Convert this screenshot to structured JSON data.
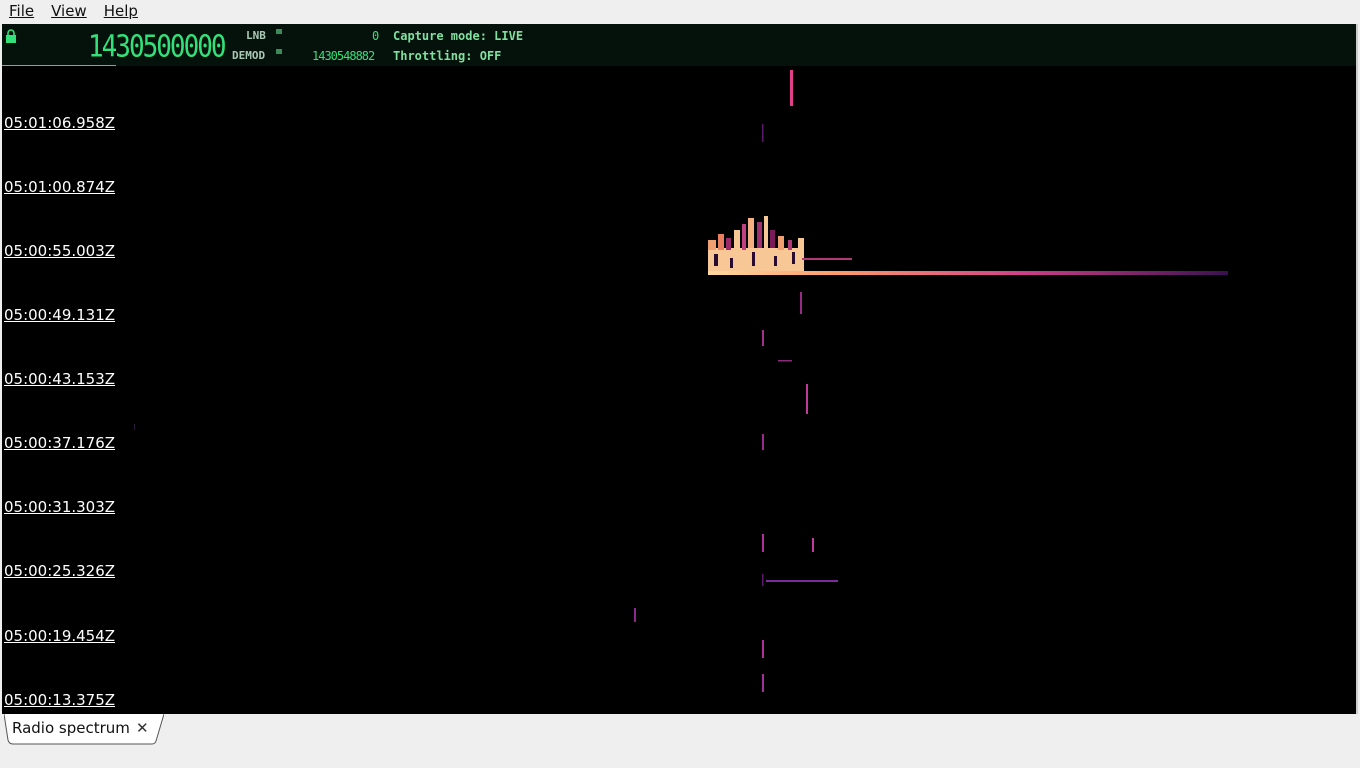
{
  "menu": {
    "file_label": "File",
    "view_label": "View",
    "help_label": "Help"
  },
  "header": {
    "main_frequency": "1430500000",
    "lnb_label": "LNB",
    "lnb_value": "0",
    "demod_label": "DEMOD",
    "demod_value": "1430548882",
    "capture_mode": "Capture mode: LIVE",
    "throttling": "Throttling: OFF",
    "accent_color": "#33e07a",
    "lock_icon": "lock-icon"
  },
  "time_axis": {
    "labels": [
      "05:01:06.958Z",
      "05:01:00.874Z",
      "05:00:55.003Z",
      "05:00:49.131Z",
      "05:00:43.153Z",
      "05:00:37.176Z",
      "05:00:31.303Z",
      "05:00:25.326Z",
      "05:00:19.454Z",
      "05:00:13.375Z"
    ]
  },
  "tabs": [
    {
      "label": "Radio spectrum",
      "close_icon": "close-icon"
    }
  ]
}
